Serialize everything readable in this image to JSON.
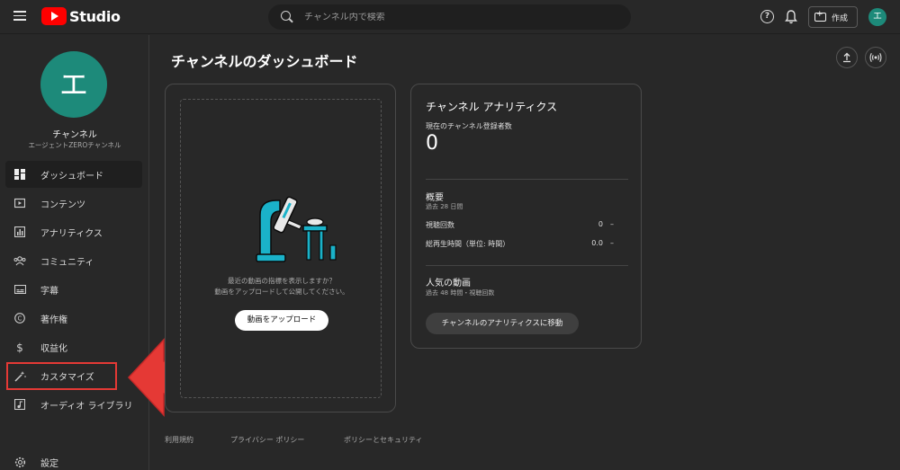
{
  "topbar": {
    "logo_text": "Studio",
    "search_placeholder": "チャンネル内で検索",
    "help_glyph": "?",
    "create_label": "作成",
    "avatar_letter": "エ"
  },
  "sidebar": {
    "avatar_letter": "エ",
    "channel_title": "チャンネル",
    "channel_name": "エージェントZEROチャンネル",
    "items": [
      {
        "label": "ダッシュボード",
        "icon": "dashboard-icon",
        "active": true
      },
      {
        "label": "コンテンツ",
        "icon": "content-icon"
      },
      {
        "label": "アナリティクス",
        "icon": "analytics-icon"
      },
      {
        "label": "コミュニティ",
        "icon": "community-icon"
      },
      {
        "label": "字幕",
        "icon": "subtitles-icon"
      },
      {
        "label": "著作権",
        "icon": "copyright-icon"
      },
      {
        "label": "収益化",
        "icon": "dollar-icon"
      },
      {
        "label": "カスタマイズ",
        "icon": "magic-wand-icon"
      },
      {
        "label": "オーディオ ライブラリ",
        "icon": "audio-library-icon"
      },
      {
        "label": "設定",
        "icon": "gear-icon"
      }
    ]
  },
  "main": {
    "title": "チャンネルのダッシュボード",
    "upload_card": {
      "text_line1": "最近の動画の指標を表示しますか？",
      "text_line2": "動画をアップロードして公開してください。",
      "button": "動画をアップロード"
    },
    "analytics_card": {
      "title": "チャンネル アナリティクス",
      "subs_label": "現在のチャンネル登録者数",
      "subs_value": "0",
      "summary_title": "概要",
      "summary_period": "過去 28 日間",
      "rows": [
        {
          "label": "視聴回数",
          "value": "0",
          "delta": "–"
        },
        {
          "label": "総再生時間（単位: 時間）",
          "value": "0.0",
          "delta": "–"
        }
      ],
      "popular_title": "人気の動画",
      "popular_period": "過去 48 時間・視聴回数",
      "button": "チャンネルのアナリティクスに移動"
    },
    "footer": [
      "利用規約",
      "プライバシー ポリシー",
      "ポリシーとセキュリティ"
    ]
  },
  "colors": {
    "accent": "#1d8a7a",
    "highlight": "#e53935",
    "brand": "#ff0000"
  }
}
